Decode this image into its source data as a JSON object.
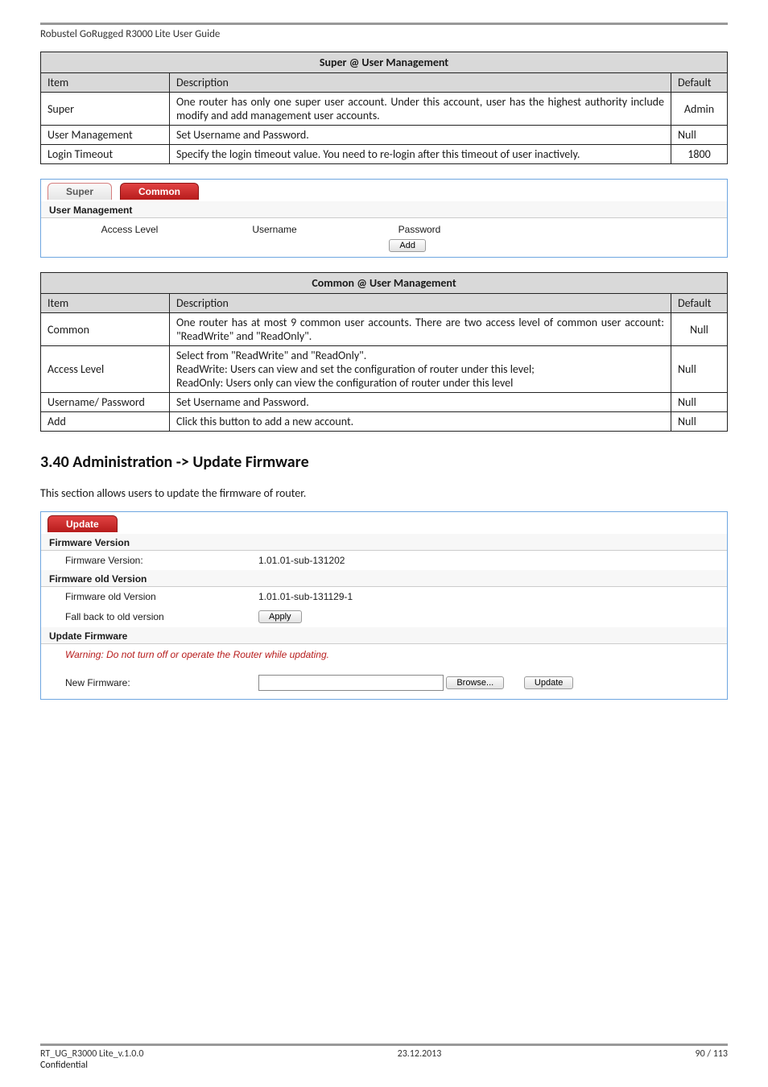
{
  "doc_header": "Robustel GoRugged R3000 Lite User Guide",
  "table1": {
    "title": "Super @ User Management",
    "cols": {
      "item": "Item",
      "desc": "Description",
      "def": "Default"
    },
    "rows": [
      {
        "item": "Super",
        "desc": "One router has only one super user account. Under this account, user has the highest authority include modify and add management user accounts.",
        "def": "Admin"
      },
      {
        "item": "User Management",
        "desc": "Set Username and Password.",
        "def": "Null"
      },
      {
        "item": "Login Timeout",
        "desc": "Specify the login timeout value. You need to re-login after this timeout of user inactively.",
        "def": "1800"
      }
    ]
  },
  "panel1": {
    "tabs": {
      "super": "Super",
      "common": "Common"
    },
    "section": "User Management",
    "headers": {
      "level": "Access Level",
      "user": "Username",
      "pass": "Password"
    },
    "add": "Add"
  },
  "table2": {
    "title": "Common @ User Management",
    "cols": {
      "item": "Item",
      "desc": "Description",
      "def": "Default"
    },
    "rows": [
      {
        "item": "Common",
        "desc": "One router has at most 9 common user accounts. There are two access level of common user account: \"ReadWrite\" and \"ReadOnly\".",
        "def": "Null"
      },
      {
        "item": "Access Level",
        "desc_lines": [
          "Select from \"ReadWrite\" and \"ReadOnly\".",
          "ReadWrite: Users can view and set the configuration of router under this level;",
          "ReadOnly: Users only can view the configuration of router under this level"
        ],
        "def": "Null"
      },
      {
        "item": "Username/ Password",
        "desc": "Set Username and Password.",
        "def": "Null"
      },
      {
        "item": "Add",
        "desc": "Click this button to add a new account.",
        "def": "Null"
      }
    ]
  },
  "section_heading": "3.40  Administration -> Update Firmware",
  "section_intro": "This section allows users to update the firmware of router.",
  "panel2": {
    "tab": "Update",
    "s1": {
      "title": "Firmware Version",
      "label": "Firmware Version:",
      "value": "1.01.01-sub-131202"
    },
    "s2": {
      "title": "Firmware old Version",
      "l1": "Firmware old Version",
      "v1": "1.01.01-sub-131129-1",
      "l2": "Fall back to old version",
      "apply": "Apply"
    },
    "s3": {
      "title": "Update Firmware",
      "warning": "Warning: Do not turn off or operate the Router while updating.",
      "label": "New Firmware:",
      "browse": "Browse...",
      "update": "Update"
    }
  },
  "footer": {
    "left": "RT_UG_R3000 Lite_v.1.0.0",
    "center": "23.12.2013",
    "right": "90 / 113",
    "conf": "Confidential"
  }
}
